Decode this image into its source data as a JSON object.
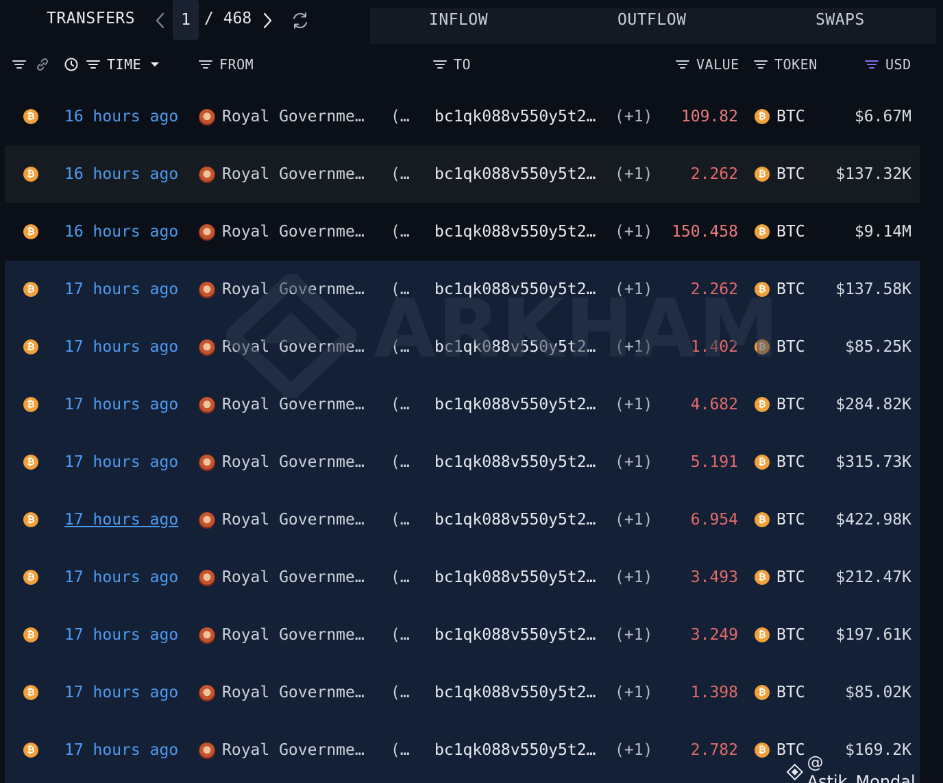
{
  "topbar": {
    "title": "TRANSFERS",
    "page": "1",
    "total": "/ 468",
    "tabs": [
      "INFLOW",
      "OUTFLOW",
      "SWAPS"
    ]
  },
  "columns": {
    "time": "TIME",
    "from": "FROM",
    "to": "TO",
    "value": "VALUE",
    "token": "TOKEN",
    "usd": "USD"
  },
  "rows": [
    {
      "time": "16 hours ago",
      "from": "Royal Governme…",
      "paren": "(…",
      "to": "bc1qk088v550y5t2…",
      "plus": "(+1)",
      "value": "109.82",
      "token": "BTC",
      "usd": "$6.67M"
    },
    {
      "time": "16 hours ago",
      "from": "Royal Governme…",
      "paren": "(…",
      "to": "bc1qk088v550y5t2…",
      "plus": "(+1)",
      "value": "2.262",
      "token": "BTC",
      "usd": "$137.32K"
    },
    {
      "time": "16 hours ago",
      "from": "Royal Governme…",
      "paren": "(…",
      "to": "bc1qk088v550y5t2…",
      "plus": "(+1)",
      "value": "150.458",
      "token": "BTC",
      "usd": "$9.14M"
    },
    {
      "time": "17 hours ago",
      "from": "Royal Governme…",
      "paren": "(…",
      "to": "bc1qk088v550y5t2…",
      "plus": "(+1)",
      "value": "2.262",
      "token": "BTC",
      "usd": "$137.58K"
    },
    {
      "time": "17 hours ago",
      "from": "Royal Governme…",
      "paren": "(…",
      "to": "bc1qk088v550y5t2…",
      "plus": "(+1)",
      "value": "1.402",
      "token": "BTC",
      "usd": "$85.25K"
    },
    {
      "time": "17 hours ago",
      "from": "Royal Governme…",
      "paren": "(…",
      "to": "bc1qk088v550y5t2…",
      "plus": "(+1)",
      "value": "4.682",
      "token": "BTC",
      "usd": "$284.82K"
    },
    {
      "time": "17 hours ago",
      "from": "Royal Governme…",
      "paren": "(…",
      "to": "bc1qk088v550y5t2…",
      "plus": "(+1)",
      "value": "5.191",
      "token": "BTC",
      "usd": "$315.73K"
    },
    {
      "time": "17 hours ago",
      "from": "Royal Governme…",
      "paren": "(…",
      "to": "bc1qk088v550y5t2…",
      "plus": "(+1)",
      "value": "6.954",
      "token": "BTC",
      "usd": "$422.98K"
    },
    {
      "time": "17 hours ago",
      "from": "Royal Governme…",
      "paren": "(…",
      "to": "bc1qk088v550y5t2…",
      "plus": "(+1)",
      "value": "3.493",
      "token": "BTC",
      "usd": "$212.47K"
    },
    {
      "time": "17 hours ago",
      "from": "Royal Governme…",
      "paren": "(…",
      "to": "bc1qk088v550y5t2…",
      "plus": "(+1)",
      "value": "3.249",
      "token": "BTC",
      "usd": "$197.61K"
    },
    {
      "time": "17 hours ago",
      "from": "Royal Governme…",
      "paren": "(…",
      "to": "bc1qk088v550y5t2…",
      "plus": "(+1)",
      "value": "1.398",
      "token": "BTC",
      "usd": "$85.02K"
    },
    {
      "time": "17 hours ago",
      "from": "Royal Governme…",
      "paren": "(…",
      "to": "bc1qk088v550y5t2…",
      "plus": "(+1)",
      "value": "2.782",
      "token": "BTC",
      "usd": "$169.2K"
    }
  ],
  "watermark": "ARKHAM",
  "credit": "@ Astik_Mondal_",
  "colors": {
    "background": "#0b1018",
    "highlight_row": "#142036",
    "time_link": "#4d9bf0",
    "outflow_value": "#e36a6a",
    "btc": "#f2a03a",
    "usd_filter_active": "#8a6cf0"
  }
}
